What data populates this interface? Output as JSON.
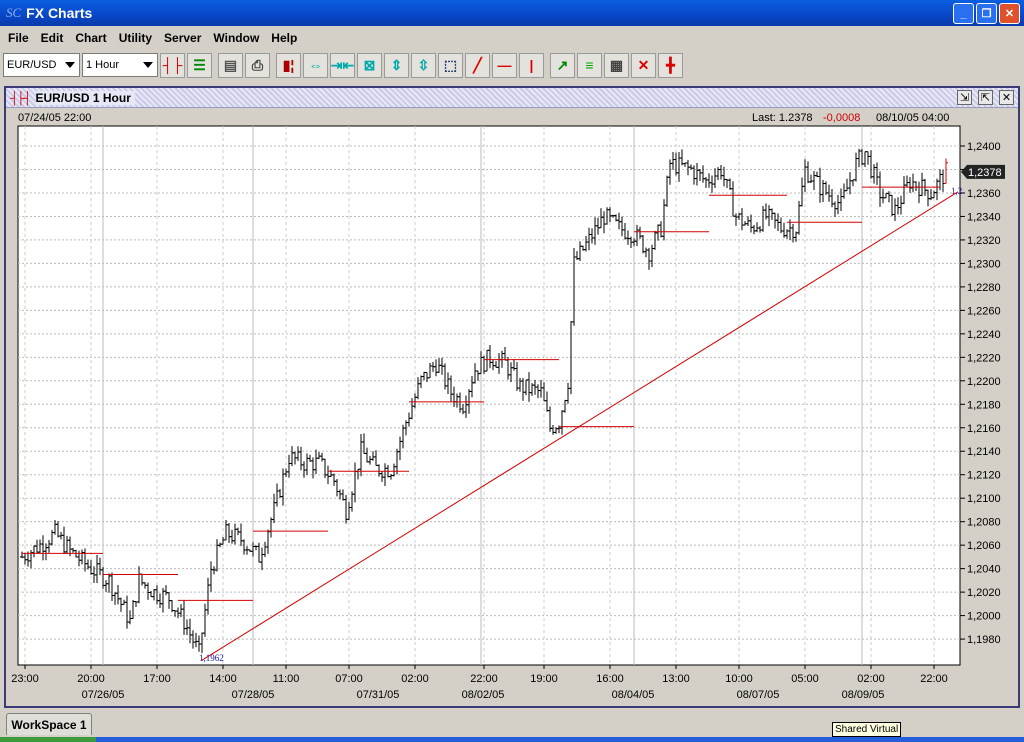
{
  "window": {
    "title": "FX Charts",
    "logo": "SC",
    "minimize": "_",
    "maximize": "❐",
    "close": "✕"
  },
  "menu": [
    "File",
    "Edit",
    "Chart",
    "Utility",
    "Server",
    "Window",
    "Help"
  ],
  "toolbar": {
    "symbol": "EUR/USD",
    "timeframe": "1 Hour",
    "icons": [
      "bar-chart-icon",
      "list-icon",
      "network-icon",
      "print-icon",
      "candlestick-icon",
      "expand-horizontal-icon",
      "compress-horizontal-icon",
      "fit-icon",
      "expand-vertical-icon",
      "compress-vertical-icon",
      "zoom-select-icon",
      "trendline-icon",
      "horizontal-line-icon",
      "vertical-line-icon",
      "indicator-icon",
      "fibonacci-icon",
      "grid-icon",
      "delete-icon",
      "crosshair-icon"
    ]
  },
  "chart_window": {
    "title": "EUR/USD 1 Hour",
    "start_time": "07/24/05 22:00",
    "last_label": "Last: 1.2378",
    "change": "-0,0008",
    "end_time": "08/10/05 04:00",
    "last_badge": "1,2378",
    "low_label": "1,1962",
    "trend_end_label": "1,2"
  },
  "colors": {
    "accent": "#d40000",
    "bars": "#000000",
    "trend": "#d40000",
    "label_blue": "#1a1aa0"
  },
  "chart_data": {
    "type": "bar",
    "title": "EUR/USD 1 Hour",
    "ylim": [
      1.1955,
      1.2417
    ],
    "y_ticks": [
      "1,1980",
      "1,2000",
      "1,2020",
      "1,2040",
      "1,2060",
      "1,2080",
      "1,2100",
      "1,2120",
      "1,2140",
      "1,2160",
      "1,2180",
      "1,2200",
      "1,2220",
      "1,2240",
      "1,2260",
      "1,2280",
      "1,2300",
      "1,2320",
      "1,2340",
      "1,2360",
      "1,2380",
      "1,2400"
    ],
    "x_ticks": [
      "23:00",
      "20:00",
      "17:00",
      "14:00",
      "11:00",
      "07:00",
      "02:00",
      "22:00",
      "19:00",
      "16:00",
      "13:00",
      "10:00",
      "05:00",
      "02:00",
      "22:00"
    ],
    "x_dates": [
      "07/26/05",
      "07/28/05",
      "07/31/05",
      "08/02/05",
      "08/04/05",
      "08/07/05",
      "08/09/05"
    ],
    "bar_count": 312,
    "price_path": [
      [
        0,
        1.205
      ],
      [
        6,
        1.206
      ],
      [
        11,
        1.207
      ],
      [
        16,
        1.2055
      ],
      [
        23,
        1.204
      ],
      [
        29,
        1.203
      ],
      [
        33,
        1.201
      ],
      [
        36,
        1.1995
      ],
      [
        39,
        1.203
      ],
      [
        44,
        1.202
      ],
      [
        49,
        1.2015
      ],
      [
        54,
        1.1995
      ],
      [
        59,
        1.1968
      ],
      [
        63,
        1.204
      ],
      [
        68,
        1.207
      ],
      [
        73,
        1.2065
      ],
      [
        79,
        1.205
      ],
      [
        84,
        1.209
      ],
      [
        89,
        1.2135
      ],
      [
        94,
        1.213
      ],
      [
        99,
        1.213
      ],
      [
        104,
        1.2115
      ],
      [
        108,
        1.209
      ],
      [
        113,
        1.214
      ],
      [
        118,
        1.2125
      ],
      [
        123,
        1.2125
      ],
      [
        128,
        1.2165
      ],
      [
        133,
        1.22
      ],
      [
        138,
        1.2215
      ],
      [
        143,
        1.219
      ],
      [
        147,
        1.218
      ],
      [
        151,
        1.221
      ],
      [
        156,
        1.222
      ],
      [
        161,
        1.2215
      ],
      [
        166,
        1.2195
      ],
      [
        173,
        1.219
      ],
      [
        176,
        1.216
      ],
      [
        179,
        1.2165
      ],
      [
        182,
        1.22
      ],
      [
        184,
        1.23
      ],
      [
        189,
        1.232
      ],
      [
        194,
        1.234
      ],
      [
        199,
        1.233
      ],
      [
        204,
        1.2325
      ],
      [
        209,
        1.231
      ],
      [
        213,
        1.233
      ],
      [
        216,
        1.2385
      ],
      [
        223,
        1.238
      ],
      [
        228,
        1.237
      ],
      [
        233,
        1.238
      ],
      [
        238,
        1.234
      ],
      [
        243,
        1.233
      ],
      [
        248,
        1.234
      ],
      [
        253,
        1.233
      ],
      [
        258,
        1.233
      ],
      [
        261,
        1.238
      ],
      [
        266,
        1.2365
      ],
      [
        273,
        1.235
      ],
      [
        278,
        1.2385
      ],
      [
        281,
        1.2395
      ],
      [
        286,
        1.236
      ],
      [
        291,
        1.2345
      ],
      [
        296,
        1.237
      ],
      [
        303,
        1.236
      ],
      [
        308,
        1.2378
      ]
    ],
    "pivot_lines": [
      [
        0,
        27,
        1.2053
      ],
      [
        27,
        52,
        1.2035
      ],
      [
        52,
        77,
        1.2013
      ],
      [
        77,
        102,
        1.2072
      ],
      [
        102,
        129,
        1.2123
      ],
      [
        129,
        154,
        1.2182
      ],
      [
        154,
        179,
        1.2218
      ],
      [
        179,
        204,
        1.2161
      ],
      [
        204,
        229,
        1.2327
      ],
      [
        229,
        255,
        1.2358
      ],
      [
        255,
        280,
        1.2335
      ],
      [
        280,
        306,
        1.2365
      ]
    ],
    "trendline": [
      [
        60,
        1.1962
      ],
      [
        312,
        1.2361
      ]
    ],
    "day_separators": [
      27,
      77,
      153,
      204,
      280
    ],
    "x_tick_bars": [
      1,
      23,
      45,
      67,
      88,
      109,
      131,
      154,
      174,
      196,
      218,
      239,
      261,
      283,
      304
    ]
  },
  "workspace": {
    "tab": "WorkSpace 1",
    "tooltip": "Shared Virtual"
  }
}
